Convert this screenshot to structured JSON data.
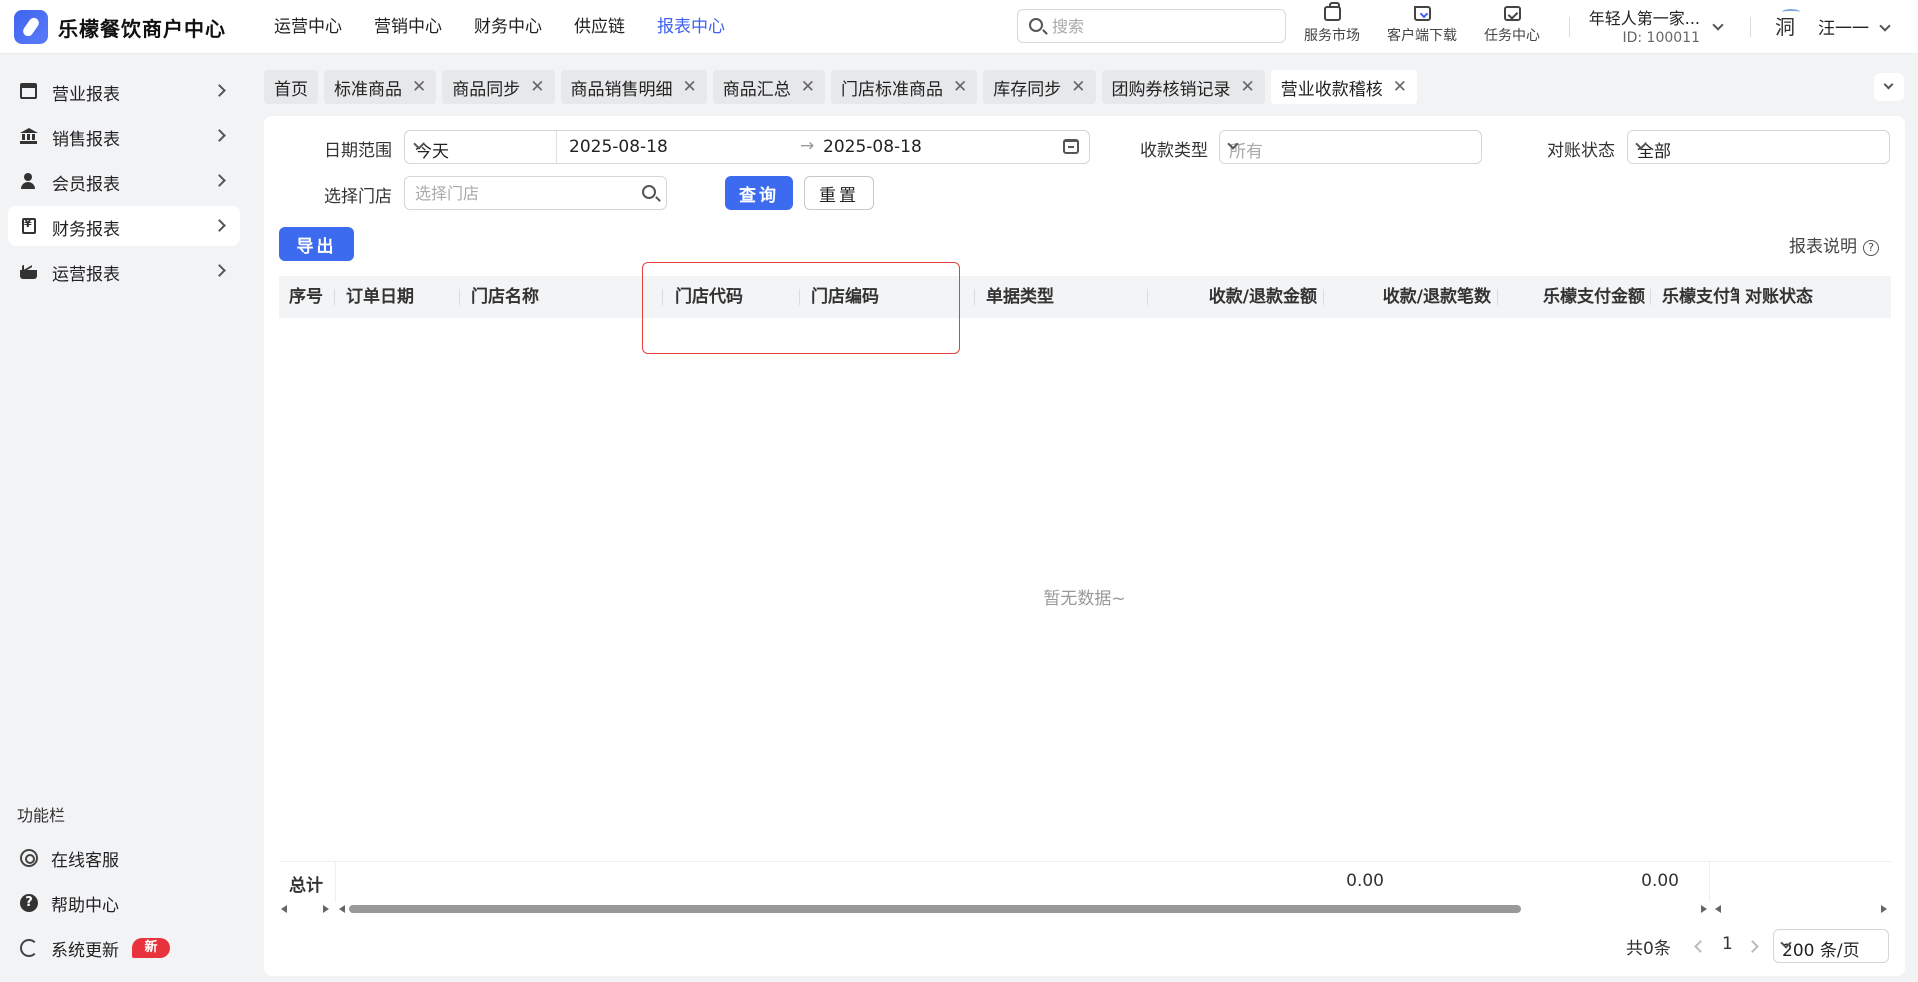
{
  "app": {
    "brand": "乐檬餐饮商户中心"
  },
  "topnav": [
    {
      "label": "运营中心",
      "active": false
    },
    {
      "label": "营销中心",
      "active": false
    },
    {
      "label": "财务中心",
      "active": false
    },
    {
      "label": "供应链",
      "active": false
    },
    {
      "label": "报表中心",
      "active": true
    }
  ],
  "search": {
    "placeholder": "搜索"
  },
  "tools": {
    "market": "服务市场",
    "download": "客户端下载",
    "tasks": "任务中心"
  },
  "account": {
    "name": "年轻人第一家...",
    "id": "ID: 100011"
  },
  "user": {
    "avatar": "洞",
    "name": "汪一一"
  },
  "sidebar": {
    "items": [
      {
        "label": "营业报表",
        "icon": "store-icon"
      },
      {
        "label": "销售报表",
        "icon": "bank-icon"
      },
      {
        "label": "会员报表",
        "icon": "person-icon"
      },
      {
        "label": "财务报表",
        "icon": "finance-doc-icon",
        "active": true
      },
      {
        "label": "运营报表",
        "icon": "chart-icon"
      }
    ],
    "func_title": "功能栏",
    "func": {
      "service": "在线客服",
      "help": "帮助中心",
      "update": "系统更新",
      "help_glyph": "?"
    },
    "new_badge": "新"
  },
  "tabs": [
    {
      "label": "首页",
      "closable": false
    },
    {
      "label": "标准商品",
      "closable": true
    },
    {
      "label": "商品同步",
      "closable": true
    },
    {
      "label": "商品销售明细",
      "closable": true
    },
    {
      "label": "商品汇总",
      "closable": true
    },
    {
      "label": "门店标准商品",
      "closable": true
    },
    {
      "label": "库存同步",
      "closable": true
    },
    {
      "label": "团购券核销记录",
      "closable": true
    },
    {
      "label": "营业收款稽核",
      "closable": true,
      "active": true
    }
  ],
  "filters": {
    "date_label": "日期范围",
    "date_preset": "今天",
    "date_start": "2025-08-18",
    "date_sep": "→",
    "date_end": "2025-08-18",
    "pay_type_label": "收款类型",
    "pay_type_value": "所有",
    "recon_label": "对账状态",
    "recon_value": "全部",
    "store_label": "选择门店",
    "store_placeholder": "选择门店",
    "query": "查询",
    "reset": "重置"
  },
  "actions": {
    "export": "导出",
    "report_help": "报表说明",
    "help_glyph": "?"
  },
  "table": {
    "columns": [
      "序号",
      "订单日期",
      "门店名称",
      "门店代码",
      "门店编码",
      "单据类型",
      "收款/退款金额",
      "收款/退款笔数",
      "乐檬支付金额",
      "乐檬支付笔",
      "对账状态"
    ],
    "empty": "暂无数据~",
    "summary_label": "总计",
    "summary_amount": "0.00",
    "summary_lemeng": "0.00"
  },
  "pagination": {
    "total": "共0条",
    "page": "1",
    "page_size": "200 条/页"
  },
  "colors": {
    "accent": "#3d6bf0",
    "highlight": "#e2413c",
    "badge": "#e8323c"
  }
}
